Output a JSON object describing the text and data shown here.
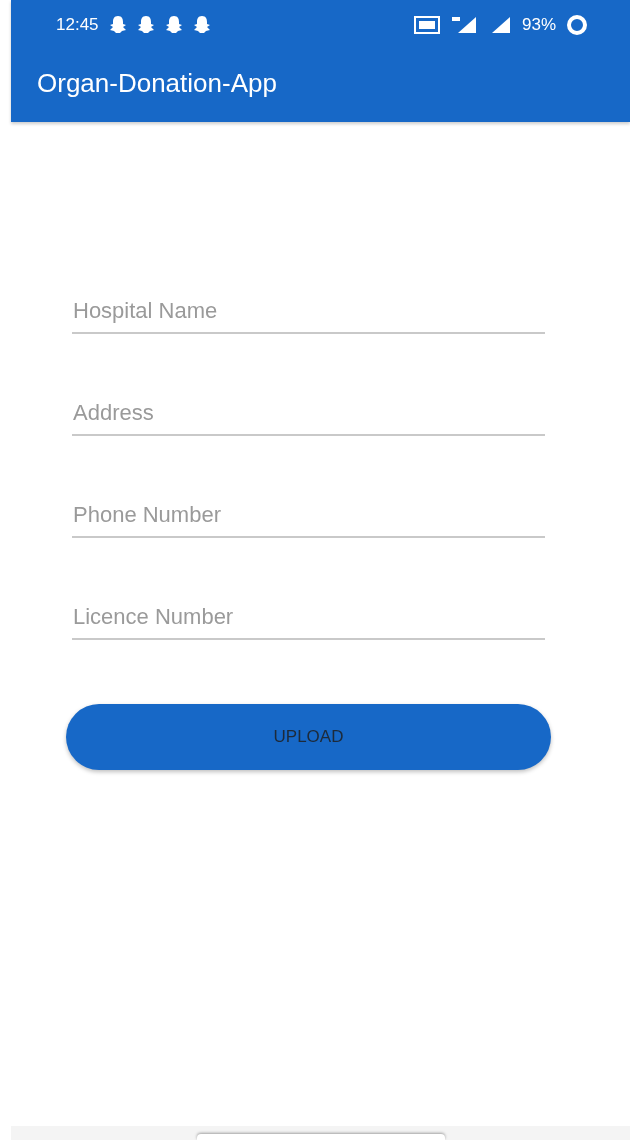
{
  "status_bar": {
    "time": "12:45",
    "battery": "93%"
  },
  "app_bar": {
    "title": "Organ-Donation-App"
  },
  "fields": [
    {
      "placeholder": "Hospital Name"
    },
    {
      "placeholder": "Address"
    },
    {
      "placeholder": "Phone Number"
    },
    {
      "placeholder": "Licence Number"
    }
  ],
  "button": {
    "label": "UPLOAD"
  }
}
